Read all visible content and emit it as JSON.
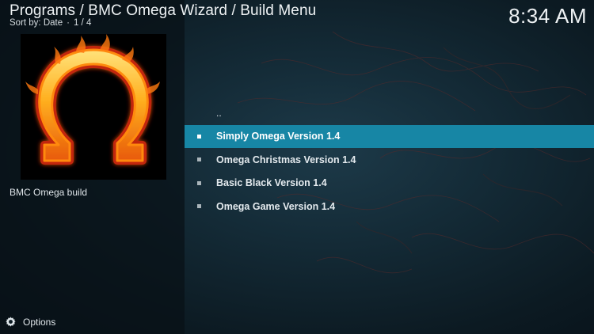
{
  "header": {
    "breadcrumb": "Programs / BMC Omega Wizard / Build Menu",
    "sort_label": "Sort by: Date",
    "separator": "·",
    "page_count": "1 / 4",
    "clock": "8:34 AM"
  },
  "sidebar": {
    "thumbnail_icon": "omega-fire-icon",
    "caption": "BMC Omega build"
  },
  "list": {
    "parent_label": "..",
    "items": [
      {
        "label": "Simply Omega Version 1.4",
        "selected": true
      },
      {
        "label": "Omega Christmas Version 1.4",
        "selected": false
      },
      {
        "label": "Basic Black Version 1.4",
        "selected": false
      },
      {
        "label": "Omega Game Version 1.4",
        "selected": false
      }
    ]
  },
  "footer": {
    "options_label": "Options",
    "options_icon": "options-icon"
  },
  "colors": {
    "selection": "#1786a5",
    "background": "#142b37",
    "panel": "#08121a"
  }
}
